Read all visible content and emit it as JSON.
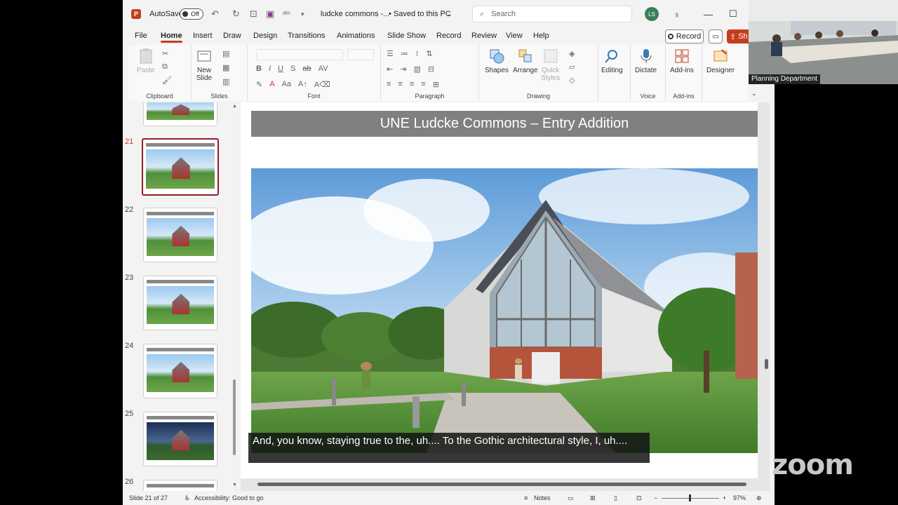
{
  "titlebar": {
    "autosave_label": "AutoSave",
    "autosave_state": "Off",
    "file_name": "ludcke commons -...",
    "save_status": "• Saved to this PC",
    "search_placeholder": "Search",
    "user_initials": "LS"
  },
  "tabs": [
    {
      "label": "File"
    },
    {
      "label": "Home"
    },
    {
      "label": "Insert"
    },
    {
      "label": "Draw"
    },
    {
      "label": "Design"
    },
    {
      "label": "Transitions"
    },
    {
      "label": "Animations"
    },
    {
      "label": "Slide Show"
    },
    {
      "label": "Record"
    },
    {
      "label": "Review"
    },
    {
      "label": "View"
    },
    {
      "label": "Help"
    }
  ],
  "tab_actions": {
    "record_label": "Record",
    "share_label": "Sh"
  },
  "ribbon": {
    "clipboard": {
      "paste": "Paste",
      "group": "Clipboard"
    },
    "slides": {
      "new_slide_line1": "New",
      "new_slide_line2": "Slide",
      "group": "Slides"
    },
    "font": {
      "group": "Font"
    },
    "paragraph": {
      "group": "Paragraph"
    },
    "drawing": {
      "shapes": "Shapes",
      "arrange": "Arrange",
      "quick_line1": "Quick",
      "quick_line2": "Styles",
      "group": "Drawing"
    },
    "editing": {
      "label": "Editing"
    },
    "voice": {
      "dictate": "Dictate",
      "group": "Voice"
    },
    "addins": {
      "label": "Add-ins",
      "group": "Add-ins"
    },
    "designer": {
      "label": "Designer"
    }
  },
  "thumbnails": [
    {
      "num": "21",
      "active": true
    },
    {
      "num": "22",
      "active": false
    },
    {
      "num": "23",
      "active": false
    },
    {
      "num": "24",
      "active": false
    },
    {
      "num": "25",
      "active": false
    },
    {
      "num": "26",
      "active": false
    }
  ],
  "slide": {
    "title": "UNE Ludcke Commons – Entry Addition"
  },
  "statusbar": {
    "slide_pos": "Slide 21 of 27",
    "accessibility": "Accessibility: Good to go",
    "notes": "Notes",
    "zoom": "97%"
  },
  "caption": {
    "text": "And, you know, staying true to the, uh.... To the Gothic architectural style, I, uh...."
  },
  "zoom_panel": {
    "participant_label": "Planning Department",
    "logo": "zoom"
  },
  "colors": {
    "accent": "#c43e1c",
    "thumb_active": "#8f1d2c",
    "slide_title_bar": "#808080"
  }
}
